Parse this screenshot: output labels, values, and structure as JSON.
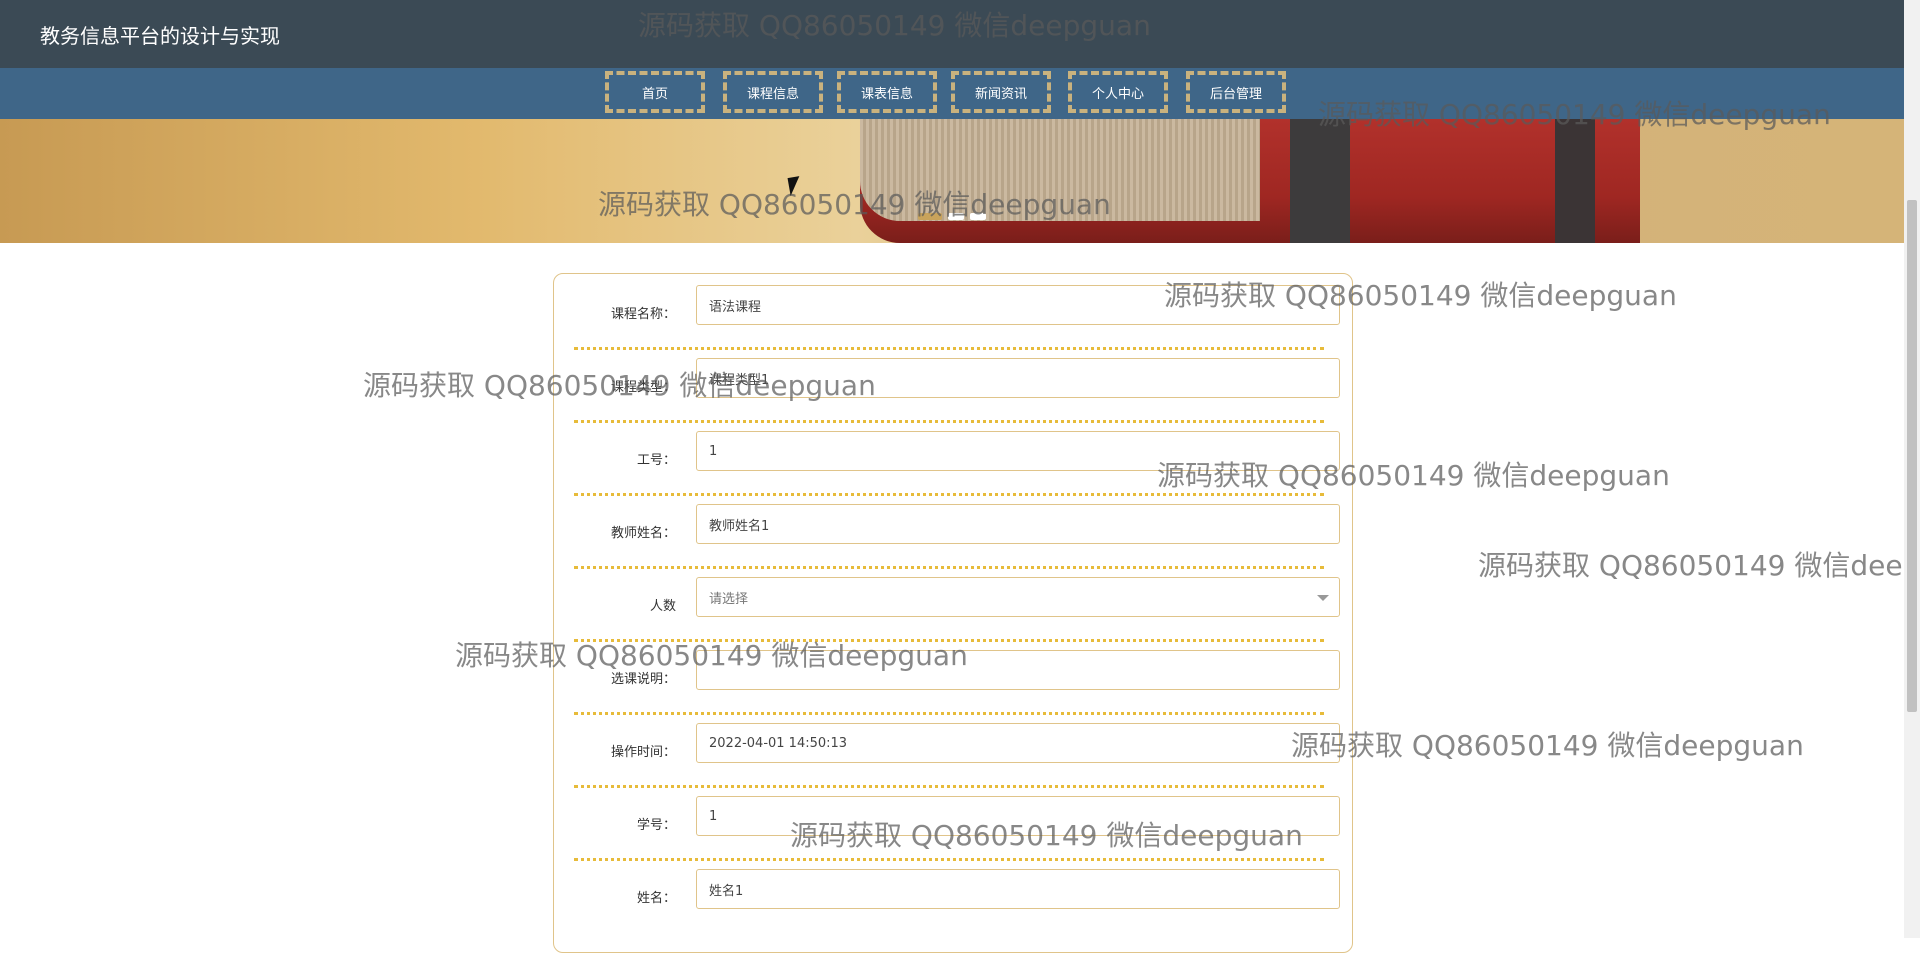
{
  "app": {
    "title": "教务信息平台的设计与实现"
  },
  "nav": {
    "items": [
      {
        "label": "首页"
      },
      {
        "label": "课程信息"
      },
      {
        "label": "课表信息"
      },
      {
        "label": "新闻资讯"
      },
      {
        "label": "个人中心"
      },
      {
        "label": "后台管理"
      }
    ]
  },
  "carousel": {
    "slides": 3,
    "active_index": 0
  },
  "form": {
    "fields": [
      {
        "label": "课程名称：",
        "value": "语法课程"
      },
      {
        "label": "课程类型：",
        "value": "课程类型1"
      },
      {
        "label": "工号：",
        "value": "1"
      },
      {
        "label": "教师姓名：",
        "value": "教师姓名1"
      },
      {
        "label": "人数",
        "placeholder": "请选择"
      },
      {
        "label": "选课说明：",
        "value": ""
      },
      {
        "label": "操作时间：",
        "value": "2022-04-01 14:50:13"
      },
      {
        "label": "学号：",
        "value": "1"
      },
      {
        "label": "姓名：",
        "value": "姓名1"
      }
    ]
  },
  "watermark": {
    "text": "源码获取 QQ86050149 微信deepguan"
  },
  "colors": {
    "topbar": "#3b4a55",
    "navbar": "#3f6688",
    "nav_border": "#c9b27e",
    "form_border": "#e0c48a",
    "row_divider": "#e7bb3a"
  }
}
